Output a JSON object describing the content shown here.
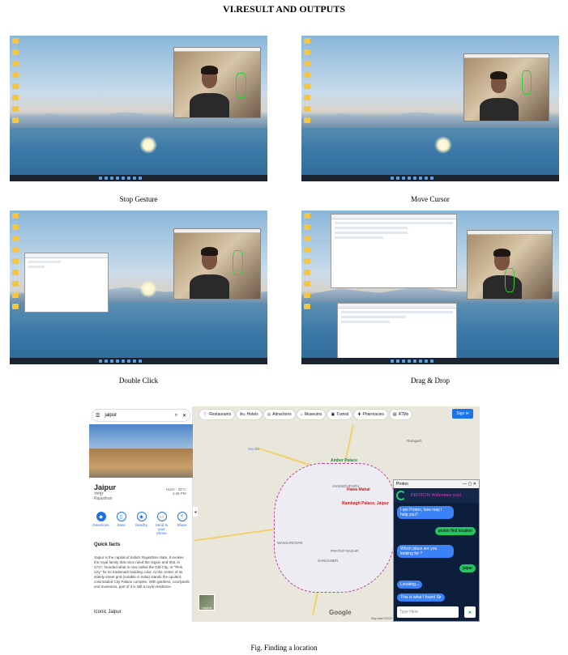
{
  "heading": "VI.RESULT  AND OUTPUTS",
  "captions": {
    "stop": "Stop Gesture",
    "move": "Move Cursor",
    "double": "Double Click",
    "drag": "Drag & Drop"
  },
  "map": {
    "search_value": "jaipur",
    "chips": [
      "Restaurants",
      "Hotels",
      "Attractions",
      "Museums",
      "Transit",
      "Pharmacies",
      "ATMs"
    ],
    "sign_in": "Sign in",
    "place_name": "Jaipur",
    "place_native": "जयपुर",
    "place_region": "Rajasthan",
    "weather": "Haze · 33°C",
    "time": "4:46 PM",
    "actions": [
      "Directions",
      "Save",
      "Nearby",
      "Send to your phone",
      "Share"
    ],
    "quick_facts_title": "Quick facts",
    "quick_facts": "Jaipur is the capital of India's Rajasthan state. It evokes the royal family that once ruled the region and that, in 1727, founded what is now called the Old City, or \"Pink City\" for its trademark building color. At the center of its stately street grid (notable in India) stands the opulent, colonnaded City Palace complex. With gardens, courtyards and museums, part of it is still a royal residence.",
    "iconic_title": "Iconic Jaipur",
    "labels": {
      "amber": "Amber Palace",
      "hawa": "Hawa Mahal",
      "rambagh": "Rambagh Palace, Jaipur",
      "morida": "Morida",
      "jaisinghpura": "JAISINGHPURA",
      "ramgarh": "Ramgarh",
      "mansarovar": "MANSAROVAR",
      "pratap": "PRATAP NAGAR",
      "sanganer": "SANGANER"
    },
    "layers": "Layers",
    "google": "Google",
    "map_data": "Map data ©2022"
  },
  "chat": {
    "window_title": "Proton",
    "welcome": "PROTON Welcomes you!",
    "messages": [
      {
        "from": "bot",
        "text": "I am Proton, how may I help you?"
      },
      {
        "from": "user",
        "text": "proton find location"
      },
      {
        "from": "bot",
        "text": "Which place are you looking for ?"
      },
      {
        "from": "user",
        "text": "jaipur"
      },
      {
        "from": "bot",
        "text": "Locating..."
      },
      {
        "from": "bot",
        "text": "This is what I found Sir"
      }
    ],
    "input_placeholder": "Type Here",
    "send_icon": "send-icon"
  },
  "figure_caption": "Fig. Finding a location"
}
